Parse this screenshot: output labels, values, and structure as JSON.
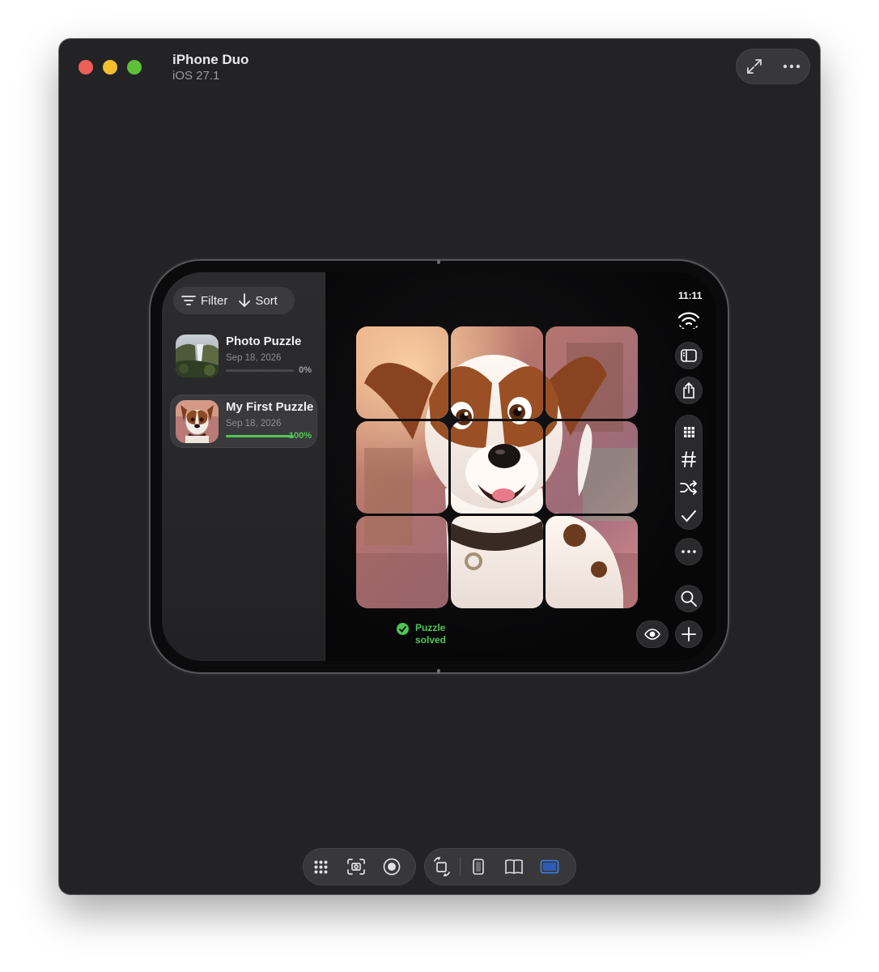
{
  "window": {
    "title": "iPhone Duo",
    "subtitle": "iOS 27.1"
  },
  "status_bar": {
    "time": "11:11"
  },
  "sidebar": {
    "filter_label": "Filter",
    "sort_label": "Sort",
    "puzzles": [
      {
        "title": "Photo Puzzle",
        "date": "Sep 18, 2026",
        "progress_text": "0%",
        "progress": 0,
        "selected": false
      },
      {
        "title": "My First Puzzle",
        "date": "Sep 18, 2026",
        "progress_text": "100%",
        "progress": 1,
        "selected": true
      }
    ]
  },
  "board": {
    "rows": 3,
    "columns": 3,
    "status_line1": "Puzzle",
    "status_line2": "solved"
  },
  "colors": {
    "accent_green": "#4fc654",
    "window_bg": "#232325",
    "selected_device_blue": "#3b82f6"
  },
  "icons": {
    "window_toolbar": [
      "expand-arrows-icon",
      "more-horizontal-icon"
    ],
    "right_rail": [
      "wifi-icon",
      "sidebar-toggle-icon",
      "share-icon",
      "grid-icon",
      "hash-icon",
      "shuffle-icon",
      "checkmark-icon",
      "more-icon",
      "search-icon",
      "eye-icon",
      "plus-icon"
    ],
    "bottom_toolbar": [
      "home-grid-icon",
      "screenshot-icon",
      "record-icon",
      "rotate-icon",
      "phone-folded-icon",
      "phone-open-portrait-icon",
      "phone-open-landscape-icon"
    ]
  }
}
